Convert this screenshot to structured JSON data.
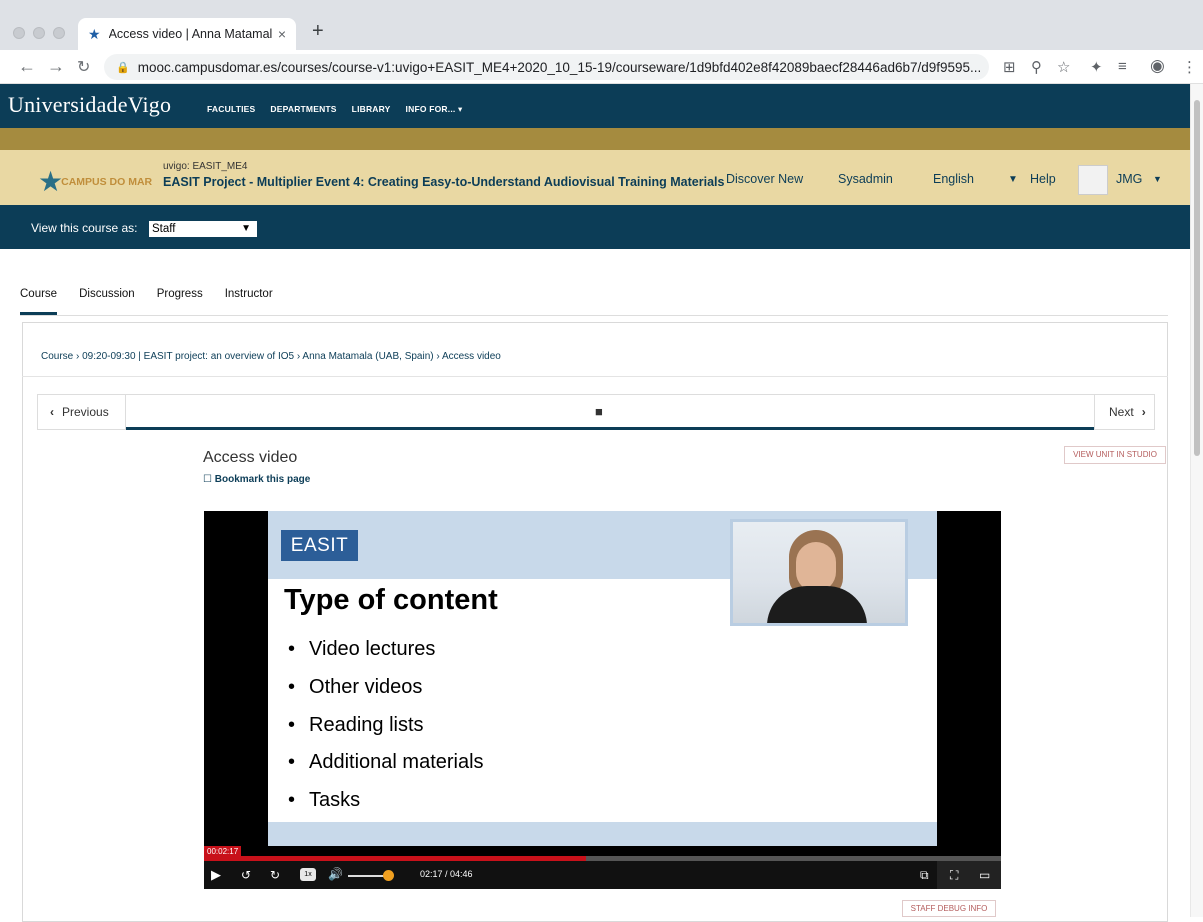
{
  "browser": {
    "tab_title": "Access video | Anna Matamala",
    "tab_close": "×",
    "new_tab": "+",
    "url": "mooc.campusdomar.es/courses/course-v1:uvigo+EASIT_ME4+2020_10_15-19/courseware/1d9bfd402e8f42089baecf28446ad6b7/d9f9595..."
  },
  "site": {
    "logo": "UniversidadeVigo",
    "nav": [
      "FACULTIES",
      "DEPARTMENTS",
      "LIBRARY",
      "INFO FOR... ▾"
    ]
  },
  "course_header": {
    "brand": "CAMPUS DO MAR",
    "org": "uvigo: EASIT_ME4",
    "name": "EASIT Project - Multiplier Event 4: Creating Easy-to-Understand Audiovisual Training Materials",
    "links": [
      "Discover New",
      "Sysadmin",
      "English",
      "Help"
    ],
    "user": "JMG"
  },
  "view_as": {
    "label": "View this course as:",
    "selected": "Staff"
  },
  "course_tabs": [
    "Course",
    "Discussion",
    "Progress",
    "Instructor"
  ],
  "breadcrumb": "Course › 09:20-09:30 | EASIT project: an overview of IO5 › Anna Matamala (UAB, Spain) › Access video",
  "sequence": {
    "prev": "Previous",
    "next": "Next"
  },
  "unit": {
    "title": "Access video",
    "bookmark": "Bookmark this page",
    "studio_button": "VIEW UNIT IN STUDIO",
    "debug_button": "STAFF DEBUG INFO"
  },
  "video": {
    "slide_logo": "EASIT",
    "slide_title": "Type of content",
    "slide_bullets": [
      "Video lectures",
      "Other videos",
      "Reading lists",
      "Additional materials",
      "Tasks"
    ],
    "current_time_chip": "00:02:17",
    "time_display": "02:17 / 04:46",
    "speed": "1x",
    "progress_fraction": 0.479,
    "volume_fraction": 0.9
  },
  "colors": {
    "header_navy": "#0c3d57",
    "gold_band": "#a58b3f",
    "course_band": "#e9d8a3",
    "progress_red": "#c8111a"
  }
}
